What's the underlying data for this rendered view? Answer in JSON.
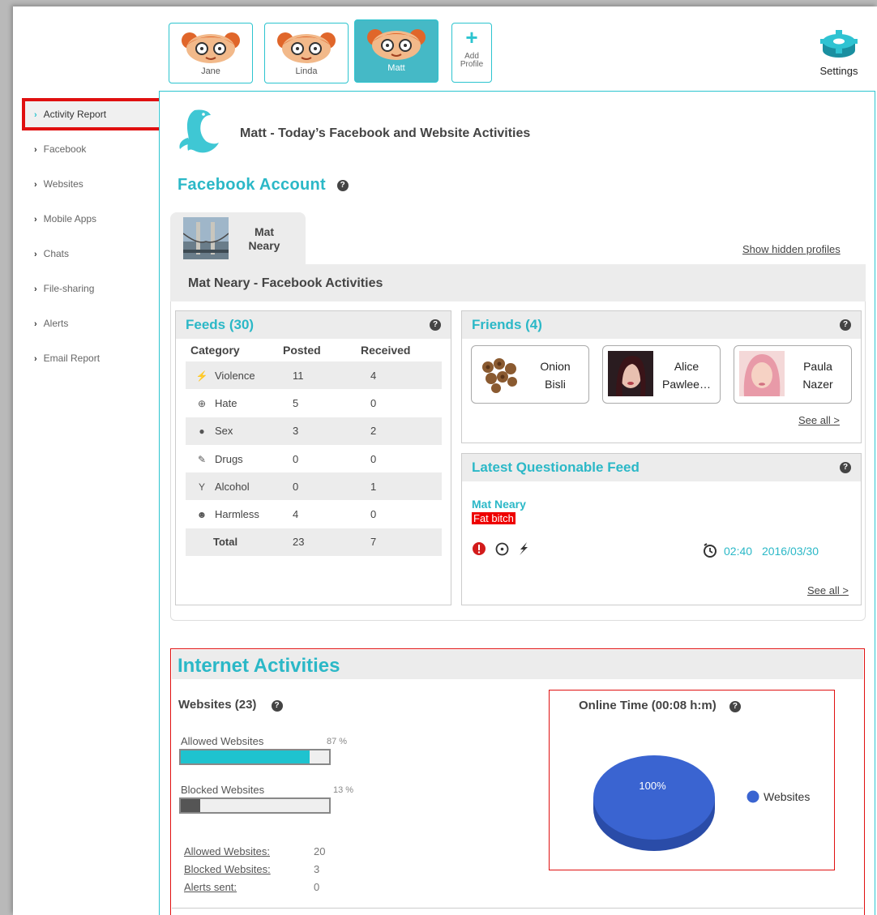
{
  "profiles": [
    {
      "name": "Jane",
      "active": false
    },
    {
      "name": "Linda",
      "active": false
    },
    {
      "name": "Matt",
      "active": true
    }
  ],
  "add_profile": {
    "icon": "plus-icon",
    "label_line1": "Add",
    "label_line2": "Profile"
  },
  "settings": {
    "icon": "gear-icon",
    "label": "Settings"
  },
  "sidebar": {
    "items": [
      {
        "label": "Activity Report",
        "active": true
      },
      {
        "label": "Facebook"
      },
      {
        "label": "Websites"
      },
      {
        "label": "Mobile Apps"
      },
      {
        "label": "Chats"
      },
      {
        "label": "File-sharing"
      },
      {
        "label": "Alerts"
      },
      {
        "label": "Email Report"
      }
    ]
  },
  "header": {
    "title": "Matt - Today’s Facebook and Website Activities",
    "logo_icon": "dolphin-icon"
  },
  "facebook": {
    "section_title": "Facebook Account",
    "profile_tab": {
      "name_line1": "Mat",
      "name_line2": "Neary"
    },
    "show_hidden": "Show hidden profiles",
    "panel_title": "Mat Neary - Facebook Activities",
    "feeds": {
      "title": "Feeds (30)",
      "columns": [
        "Category",
        "Posted",
        "Received"
      ],
      "rows": [
        {
          "icon": "lightning-icon",
          "category": "Violence",
          "posted": "11",
          "received": "4"
        },
        {
          "icon": "crosshair-icon",
          "category": "Hate",
          "posted": "5",
          "received": "0"
        },
        {
          "icon": "sex-icon",
          "category": "Sex",
          "posted": "3",
          "received": "2"
        },
        {
          "icon": "syringe-icon",
          "category": "Drugs",
          "posted": "0",
          "received": "0"
        },
        {
          "icon": "glass-icon",
          "category": "Alcohol",
          "posted": "0",
          "received": "1"
        },
        {
          "icon": "smiley-icon",
          "category": "Harmless",
          "posted": "4",
          "received": "0"
        }
      ],
      "total": {
        "label": "Total",
        "posted": "23",
        "received": "7"
      }
    },
    "friends": {
      "title": "Friends (4)",
      "items": [
        {
          "line1": "Onion",
          "line2": "Bisli"
        },
        {
          "line1": "Alice",
          "line2": "Pawlee…"
        },
        {
          "line1": "Paula",
          "line2": "Nazer"
        }
      ],
      "see_all": "See all >"
    },
    "latest": {
      "title": "Latest Questionable Feed",
      "author": "Mat Neary",
      "text": "Fat bitch",
      "time": "02:40",
      "date": "2016/03/30",
      "see_all": "See all >"
    }
  },
  "internet": {
    "title": "Internet Activities",
    "websites_title": "Websites (23)",
    "allowed_label": "Allowed Websites",
    "allowed_pct": "87 %",
    "allowed_fraction": 0.87,
    "blocked_label": "Blocked Websites",
    "blocked_pct": "13 %",
    "blocked_fraction": 0.13,
    "stats": [
      {
        "label": "Allowed Websites:",
        "value": "20"
      },
      {
        "label": "Blocked Websites:",
        "value": "3"
      },
      {
        "label": "Alerts sent:",
        "value": "0"
      }
    ],
    "online_time_title": "Online Time (00:08 h:m)",
    "colors": {
      "accent": "#2bb8c7",
      "allowed_bar": "#1ec3cf",
      "blocked_bar": "#555555",
      "pie": "#3a64d1"
    }
  },
  "chart_data": {
    "type": "pie",
    "categories": [
      "Websites"
    ],
    "values": [
      100
    ],
    "data_labels": [
      "100%"
    ],
    "legend": "right"
  }
}
